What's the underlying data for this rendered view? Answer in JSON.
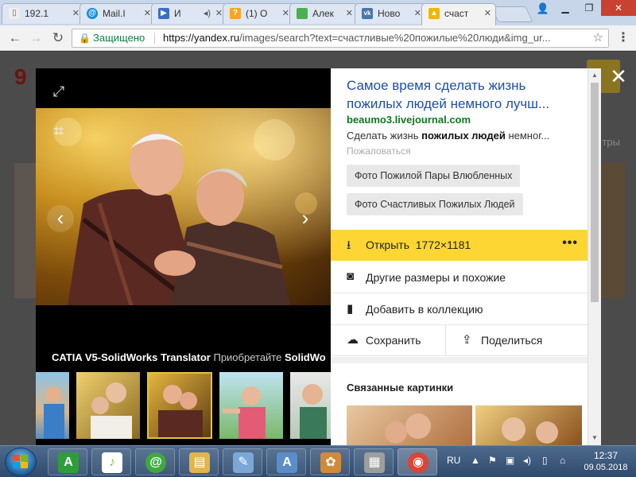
{
  "browser": {
    "tabs": [
      {
        "label": "192.1",
        "icon": "document-icon",
        "color": "#777777"
      },
      {
        "label": "Mail.I",
        "icon": "mail-ru-icon",
        "color": "#168de2"
      },
      {
        "label": "И",
        "icon": "video-icon",
        "color": "#3b6fc5"
      },
      {
        "label": "(1) О",
        "icon": "question-icon",
        "color": "#f5a623"
      },
      {
        "label": "Алек",
        "icon": "green-square-icon",
        "color": "#4caf50"
      },
      {
        "label": "Ново",
        "icon": "vk-icon",
        "color": "#4a76a8"
      },
      {
        "label": "счаст",
        "icon": "image-icon",
        "color": "#f2b600"
      }
    ],
    "secure_label": "Защищено",
    "url_host": "https://yandex.ru",
    "url_path": "/images/search?text=счастливые%20пожилые%20люди&img_ur..."
  },
  "viewer": {
    "caption_bold_1": "CATIA V5-SolidWorks Translator",
    "caption_normal": " Приобретайте ",
    "caption_bold_2": "SolidWo"
  },
  "side": {
    "title": "Самое время сделать жизнь пожилых людей немного лучш...",
    "domain": "beaumo3.livejournal.com",
    "snippet_before": "Сделать жизнь ",
    "snippet_bold": "пожилых людей",
    "snippet_after": " немног...",
    "complain": "Пожаловаться",
    "tags": [
      "Фото Пожилой Пары Влюбленных",
      "Фото Счастливых Пожилых Людей"
    ],
    "open_label": "Открыть",
    "open_size": "1772×1181",
    "more_label": "•••",
    "other_sizes": "Другие размеры и похожие",
    "add_collection": "Добавить в коллекцию",
    "save": "Сохранить",
    "share": "Поделиться",
    "related_title": "Связанные картинки"
  },
  "page": {
    "filters_fragment": "тры"
  },
  "taskbar": {
    "lang": "RU",
    "time": "12:37",
    "date": "09.05.2018",
    "apps": [
      {
        "name": "amigo-icon",
        "glyph": "A",
        "color": "#2e9e3a"
      },
      {
        "name": "music-icon",
        "glyph": "♪",
        "color": "#8bc34a"
      },
      {
        "name": "mail-agent-icon",
        "glyph": "@",
        "color": "#3fa93f"
      },
      {
        "name": "folder-icon",
        "glyph": "▤",
        "color": "#e0b64c"
      },
      {
        "name": "notepad-icon",
        "glyph": "✎",
        "color": "#7aa7d6"
      },
      {
        "name": "wordpad-icon",
        "glyph": "A",
        "color": "#5b8dc9"
      },
      {
        "name": "paint-icon",
        "glyph": "✿",
        "color": "#d08a3a"
      },
      {
        "name": "news-icon",
        "glyph": "▦",
        "color": "#9e9e9e"
      },
      {
        "name": "chrome-icon",
        "glyph": "◉",
        "color": "#db4437"
      }
    ]
  }
}
